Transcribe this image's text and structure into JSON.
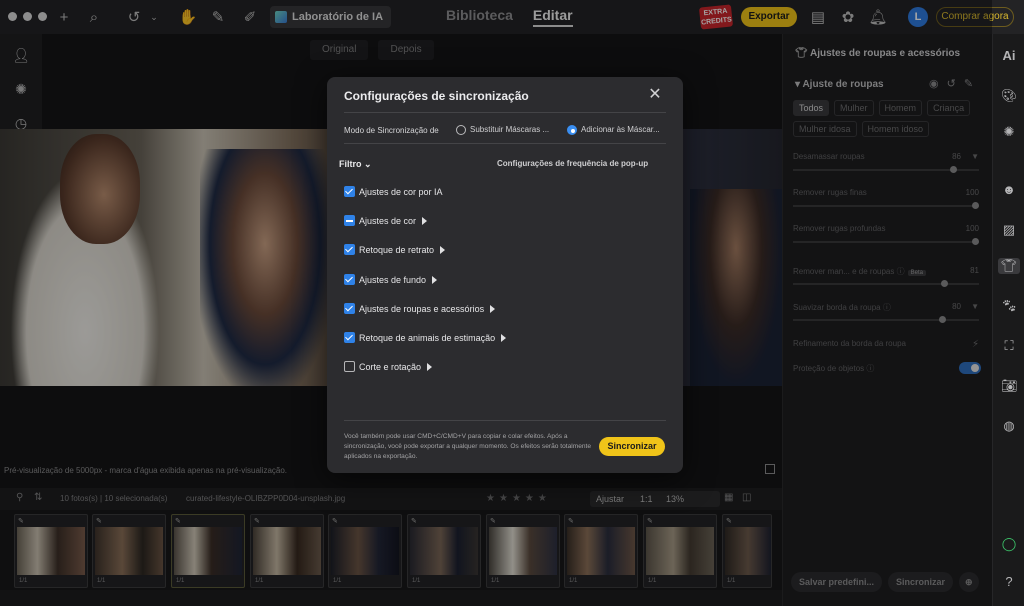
{
  "topbar": {
    "lab_label": "Laboratório de IA",
    "tab_library": "Biblioteca",
    "tab_edit": "Editar",
    "extra_badge": "EXTRA CREDITS",
    "export_label": "Exportar",
    "avatar_letter": "L",
    "buy_label": "Comprar agora"
  },
  "canvas": {
    "original_label": "Original",
    "after_label": "Depois",
    "preview_note": "Pré-visualização de 5000px - marca d'água exibida apenas na pré-visualização."
  },
  "filmstrip": {
    "count_label": "10 fotos(s) | 10 selecionada(s)",
    "filename": "curated-lifestyle-OLIBZPP0D04-unsplash.jpg",
    "fit_label": "Ajustar",
    "ratio_label": "1:1",
    "zoom_label": "13%",
    "thumb_count": "1/1"
  },
  "panel": {
    "title": "Ajustes de roupas e acessórios",
    "section": "Ajuste de roupas",
    "chips": [
      "Todos",
      "Mulher",
      "Homem",
      "Criança",
      "Mulher idosa",
      "Homem idoso"
    ],
    "sliders": [
      {
        "label": "Desamassar roupas",
        "value": "86"
      },
      {
        "label": "Remover rugas finas",
        "value": "100"
      },
      {
        "label": "Remover rugas profundas",
        "value": "100"
      },
      {
        "label": "Remover man... e de roupas",
        "value": "81",
        "badge": "Beta"
      },
      {
        "label": "Suavizar borda da roupa",
        "value": "80"
      }
    ],
    "refine_label": "Refinamento da borda da roupa",
    "protect_label": "Proteção de objetos",
    "save_preset": "Salvar predefini...",
    "sync_button": "Sincronizar"
  },
  "modal": {
    "title": "Configurações de sincronização",
    "sync_mode_label": "Modo de Sincronização de",
    "radio_replace": "Substituir Máscaras ...",
    "radio_add": "Adicionar às Máscar...",
    "filter_label": "Filtro",
    "popup_freq_label": "Configurações de frequência de pop-up",
    "options": [
      {
        "label": "Ajustes de cor por IA",
        "state": "checked",
        "submenu": false
      },
      {
        "label": "Ajustes de cor",
        "state": "partial",
        "submenu": true
      },
      {
        "label": "Retoque de retrato",
        "state": "checked",
        "submenu": true
      },
      {
        "label": "Ajustes de fundo",
        "state": "checked",
        "submenu": true
      },
      {
        "label": "Ajustes de roupas e acessórios",
        "state": "checked",
        "submenu": true
      },
      {
        "label": "Retoque de animais de estimação",
        "state": "checked",
        "submenu": true
      },
      {
        "label": "Corte e rotação",
        "state": "unchecked",
        "submenu": true
      }
    ],
    "note": "Você também pode usar CMD+C/CMD+V para copiar e colar efeitos. Após a sincronização, você pode exportar a qualquer momento. Os efeitos serão totalmente aplicados na exportação.",
    "sync_button": "Sincronizar"
  },
  "colors": {
    "accent_yellow": "#f0c419",
    "checkbox_blue": "#2f82e8",
    "dialog_bg": "#2c2c2f"
  }
}
